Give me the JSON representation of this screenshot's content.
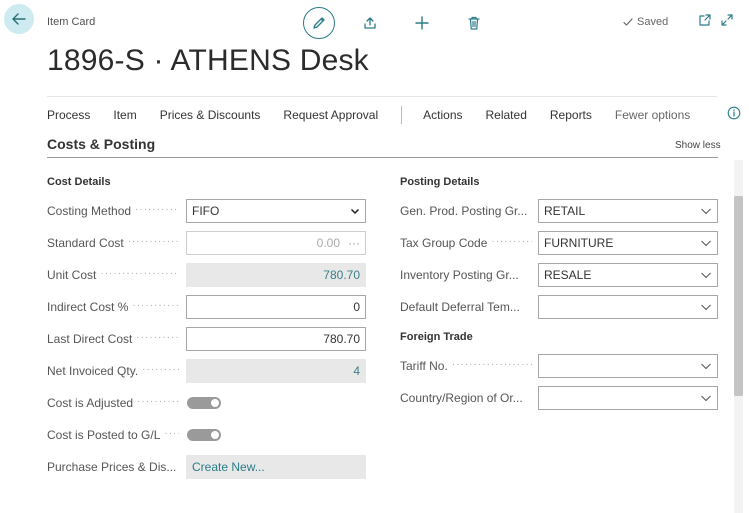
{
  "header": {
    "breadcrumb": "Item Card",
    "saved": "Saved",
    "title": "1896-S · ATHENS Desk"
  },
  "action_bar": {
    "left_items": [
      "Process",
      "Item",
      "Prices & Discounts",
      "Request Approval"
    ],
    "right_items": [
      "Actions",
      "Related",
      "Reports"
    ],
    "fewer_options": "Fewer options"
  },
  "section": {
    "title": "Costs & Posting",
    "show_less": "Show less"
  },
  "cost_details": {
    "title": "Cost Details",
    "costing_method": {
      "label": "Costing Method",
      "value": "FIFO"
    },
    "standard_cost": {
      "label": "Standard Cost",
      "value": "0.00"
    },
    "unit_cost": {
      "label": "Unit Cost",
      "value": "780.70"
    },
    "indirect_cost": {
      "label": "Indirect Cost %",
      "value": "0"
    },
    "last_direct_cost": {
      "label": "Last Direct Cost",
      "value": "780.70"
    },
    "net_invoiced_qty": {
      "label": "Net Invoiced Qty.",
      "value": "4"
    },
    "cost_is_adjusted": {
      "label": "Cost is Adjusted",
      "value": true
    },
    "cost_is_posted": {
      "label": "Cost is Posted to G/L",
      "value": true
    },
    "purchase_prices": {
      "label": "Purchase Prices & Dis...",
      "value": "Create New..."
    }
  },
  "posting_details": {
    "title": "Posting Details",
    "gen_prod": {
      "label": "Gen. Prod. Posting Gr...",
      "value": "RETAIL"
    },
    "tax_group": {
      "label": "Tax Group Code",
      "value": "FURNITURE"
    },
    "inventory_posting": {
      "label": "Inventory Posting Gr...",
      "value": "RESALE"
    },
    "default_deferral": {
      "label": "Default Deferral Tem...",
      "value": ""
    }
  },
  "foreign_trade": {
    "title": "Foreign Trade",
    "tariff_no": {
      "label": "Tariff No.",
      "value": ""
    },
    "country_region": {
      "label": "Country/Region of Or...",
      "value": ""
    }
  },
  "colors": {
    "accent": "#2a7c86",
    "back_button_bg": "#cdebf0",
    "readonly_bg": "#e8e8e8"
  }
}
